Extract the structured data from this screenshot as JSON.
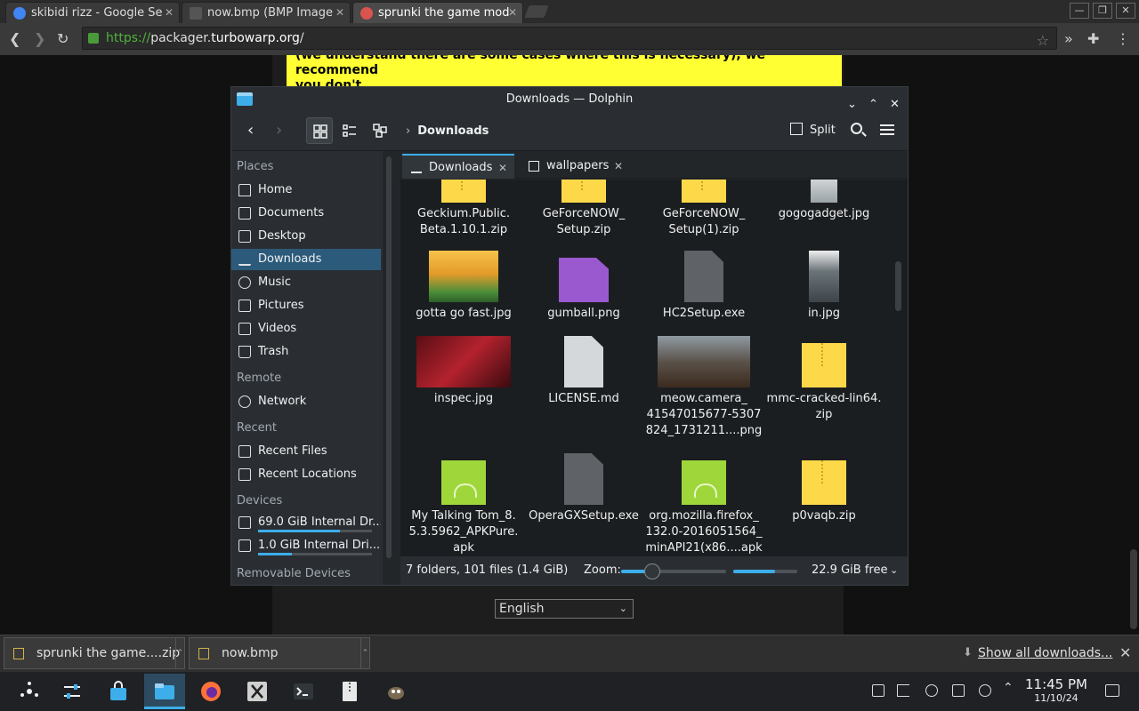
{
  "browser": {
    "tabs": [
      {
        "title": "skibidi rizz - Google Se"
      },
      {
        "title": "now.bmp (BMP Image"
      },
      {
        "title": "sprunki the game mod"
      }
    ],
    "url": {
      "scheme": "https://",
      "host_pre": "packager.",
      "host": "turbowarp.org",
      "path": "/"
    }
  },
  "page": {
    "banner_line1": "(we understand there are some cases where this is necessary), we recommend",
    "banner_line2": "you don't.",
    "language_select": "English"
  },
  "dolphin": {
    "title": "Downloads — Dolphin",
    "breadcrumb": "Downloads",
    "split_label": "Split",
    "sidebar": {
      "places_header": "Places",
      "places": [
        "Home",
        "Documents",
        "Desktop",
        "Downloads",
        "Music",
        "Pictures",
        "Videos",
        "Trash"
      ],
      "remote_header": "Remote",
      "remote": [
        "Network"
      ],
      "recent_header": "Recent",
      "recent": [
        "Recent Files",
        "Recent Locations"
      ],
      "devices_header": "Devices",
      "devices": [
        {
          "label": "69.0 GiB Internal Dr...",
          "used": 0.72
        },
        {
          "label": "1.0 GiB Internal Dri...",
          "used": 0.3
        }
      ],
      "removable_header": "Removable Devices"
    },
    "tabs": [
      {
        "label": "Downloads"
      },
      {
        "label": "wallpapers"
      }
    ],
    "files": [
      {
        "name": "Geckium.Public.\nBeta.1.10.1.zip",
        "l1": "Geckium.Public.",
        "l2": "Beta.1.10.1.zip",
        "kind": "zip"
      },
      {
        "name": "GeForceNOW_Setup.zip",
        "l1": "GeForceNOW_",
        "l2": "Setup.zip",
        "kind": "zip"
      },
      {
        "name": "GeForceNOW_Setup(1).zip",
        "l1": "GeForceNOW_",
        "l2": "Setup(1).zip",
        "kind": "zip"
      },
      {
        "name": "gogogadget.jpg",
        "l1": "gogogadget.jpg",
        "l2": "",
        "kind": "photo"
      },
      {
        "name": "gotta go fast.jpg",
        "l1": "gotta go fast.jpg",
        "l2": "",
        "kind": "photo"
      },
      {
        "name": "gumball.png",
        "l1": "gumball.png",
        "l2": "",
        "kind": "png"
      },
      {
        "name": "HC2Setup.exe",
        "l1": "HC2Setup.exe",
        "l2": "",
        "kind": "exe"
      },
      {
        "name": "in.jpg",
        "l1": "in.jpg",
        "l2": "",
        "kind": "photo"
      },
      {
        "name": "inspec.jpg",
        "l1": "inspec.jpg",
        "l2": "",
        "kind": "photo"
      },
      {
        "name": "LICENSE.md",
        "l1": "LICENSE.md",
        "l2": "",
        "kind": "md"
      },
      {
        "name": "meow.camera_4154701567...",
        "l1": "meow.camera_",
        "l2": "41547015677-5307",
        "l3": "824_1731211....png",
        "kind": "photo"
      },
      {
        "name": "mmc-cracked-lin64.zip",
        "l1": "mmc-cracked-lin64.",
        "l2": "zip",
        "kind": "zip"
      },
      {
        "name": "My Talking Tom apk",
        "l1": "My Talking Tom_8.",
        "l2": "5.3.5962_APKPure.",
        "l3": "apk",
        "kind": "apk"
      },
      {
        "name": "OperaGXSetup.exe",
        "l1": "OperaGXSetup.exe",
        "l2": "",
        "kind": "exe"
      },
      {
        "name": "org.mozilla.firefox apk",
        "l1": "org.mozilla.firefox_",
        "l2": "132.0-2016051564_",
        "l3": "minAPI21(x86....apk",
        "kind": "apk"
      },
      {
        "name": "p0vaqb.zip",
        "l1": "p0vaqb.zip",
        "l2": "",
        "kind": "zip"
      }
    ],
    "status": {
      "summary": "7 folders, 101 files (1.4 GiB)",
      "zoom_label": "Zoom:",
      "zoom_level": 0.3,
      "free_space": "22.9 GiB free",
      "free_bar_used": 0.65
    }
  },
  "downloads_shelf": {
    "items": [
      {
        "label": "sprunki the game....zip"
      },
      {
        "label": "now.bmp"
      }
    ],
    "show_all": "Show all downloads..."
  },
  "taskbar": {
    "time": "11:45 PM",
    "date": "11/10/24"
  },
  "colors": {
    "accent": "#3daee9",
    "banner": "#ffff33",
    "folder_zip": "#fdd94a",
    "apk": "#9fd63a"
  }
}
